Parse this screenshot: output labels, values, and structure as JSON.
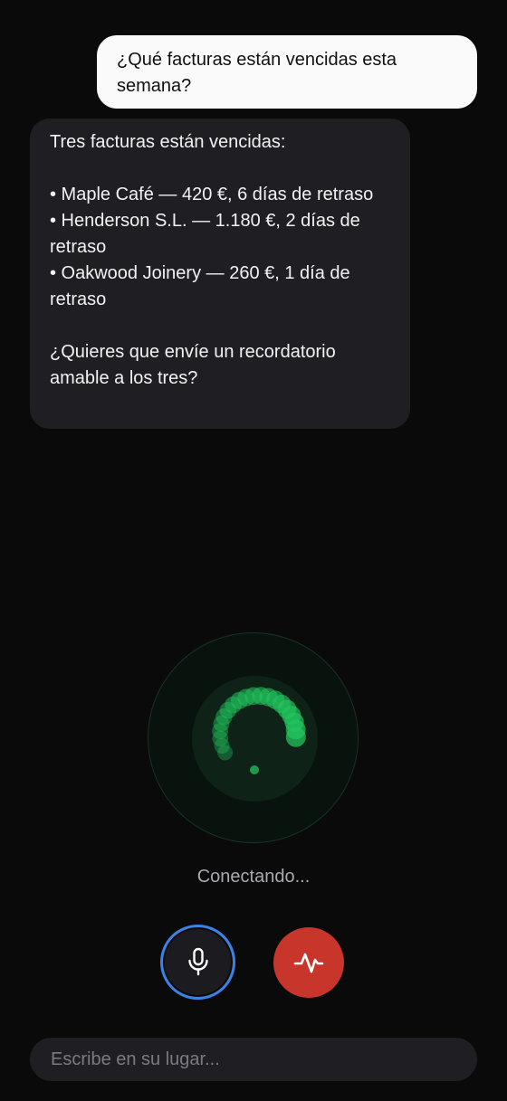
{
  "chat": {
    "user_message": "¿Qué facturas están vencidas esta semana?",
    "assistant_intro": "Tres facturas están vencidas:",
    "invoices": [
      "• Maple Café — 420 €, 6 días de retraso",
      "• Henderson S.L. — 1.180 €, 2 días de retraso",
      "• Oakwood Joinery — 260 €, 1 día de retraso"
    ],
    "assistant_question": "¿Quieres que envíe un recordatorio amable a los tres?"
  },
  "voice": {
    "status": "Conectando...",
    "accent_color": "#22c55e",
    "mic_icon": "microphone-icon",
    "end_icon": "waveform-icon",
    "end_button_color": "#c8352b",
    "mic_ring_color": "#3b82e6"
  },
  "composer": {
    "placeholder": "Escribe en su lugar..."
  }
}
